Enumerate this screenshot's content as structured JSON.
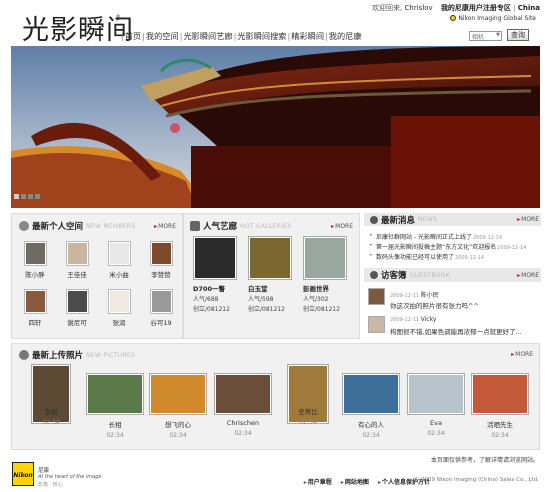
{
  "header": {
    "logo": "光影瞬间",
    "logo_beta": "β",
    "welcome_text": "欢迎回来,",
    "username": "Chrislov",
    "top_links": [
      "我的尼康用户注册专区",
      "China"
    ],
    "global_site": "Nikon Imaging Global Site",
    "nav": [
      "首页",
      "我的空间",
      "光影瞬间艺廊",
      "光影瞬间搜索",
      "精彩瞬间",
      "我的尼康"
    ],
    "search_select": "相机",
    "search_button": "查询"
  },
  "members": {
    "title": "最新个人空间",
    "subtitle": "NEW MEMBERS",
    "more": "MORE",
    "items": [
      {
        "name": "陈小胖",
        "color": "#6f6a62"
      },
      {
        "name": "王佳佳",
        "color": "#c9b6a0"
      },
      {
        "name": "米小曲",
        "color": "#e7e7e7"
      },
      {
        "name": "李赞赞",
        "color": "#7e4a2c"
      },
      {
        "name": "四轩",
        "color": "#8a5a3c"
      },
      {
        "name": "谢尼可",
        "color": "#4b4b4b"
      },
      {
        "name": "张润",
        "color": "#efe9e2"
      },
      {
        "name": "谷可19",
        "color": "#9a9a9a"
      }
    ]
  },
  "galleries": {
    "title": "人气艺廊",
    "subtitle": "HOT GALLERIES",
    "more": "MORE",
    "items": [
      {
        "title": "D700一瞥",
        "views": "人气/688",
        "created": "创立/081212",
        "color": "#2b2b2b"
      },
      {
        "title": "白玉堂",
        "views": "人气/598",
        "created": "创立/081212",
        "color": "#7a6830"
      },
      {
        "title": "彭画世界",
        "views": "人气/302",
        "created": "创立/081212",
        "color": "#98a7a0"
      }
    ]
  },
  "news": {
    "title": "最新消息",
    "subtitle": "NEWS",
    "more": "MORE",
    "items": [
      {
        "text": "尼康社群网站 - 光影瞬间正式上线了",
        "date": "2009-12-14"
      },
      {
        "text": "第一届光影瞬间投稿主题“东方文化”欢迎报名",
        "date": "2009-12-14"
      },
      {
        "text": "数码头像功能已经可以使用了",
        "date": "2009-12-14"
      }
    ]
  },
  "guestbook": {
    "title": "访客簿",
    "subtitle": "GUESTBOOK",
    "more": "MORE",
    "items": [
      {
        "date": "2009-12-11",
        "author": "陈小民",
        "text": "你这次拍的照片很有张力吗^^",
        "color": "#7a5a40"
      },
      {
        "date": "2009-12-11",
        "author": "Vicky",
        "text": "构图很不错,如果色调能再浓郁一点就更好了...",
        "color": "#c8b8a8"
      }
    ]
  },
  "pictures": {
    "title": "最新上传照片",
    "subtitle": "NEW PICTURES",
    "more": "MORE",
    "items": [
      {
        "name": "李丽",
        "time": "02:34",
        "color": "#5c4a34"
      },
      {
        "name": "长相",
        "time": "02:34",
        "color": "#5b7a4a"
      },
      {
        "name": "想飞的心",
        "time": "02:34",
        "color": "#d08a2c"
      },
      {
        "name": "Chrischen",
        "time": "02:34",
        "color": "#6a4e3a"
      },
      {
        "name": "史蒂比",
        "time": "02:34",
        "color": "#a07a3a"
      },
      {
        "name": "有心的人",
        "time": "02:34",
        "color": "#3e6e9a"
      },
      {
        "name": "Eva",
        "time": "02:34",
        "color": "#b8c4cc"
      },
      {
        "name": "活晒先生",
        "time": "02:34",
        "color": "#c55a3a"
      }
    ]
  },
  "footer": {
    "notice": "本页面仅供参考，了解详情请浏览网站。",
    "links": [
      "用户章程",
      "网站地图",
      "个人信息保护方针"
    ],
    "copyright": "© 2009 Nikon Imaging (China) Sales Co., Ltd.",
    "brand": "Nikon",
    "tagline_cn": "尼康",
    "tagline_en": "At the heart of the image",
    "tagline_small": "影像 · 核心"
  }
}
